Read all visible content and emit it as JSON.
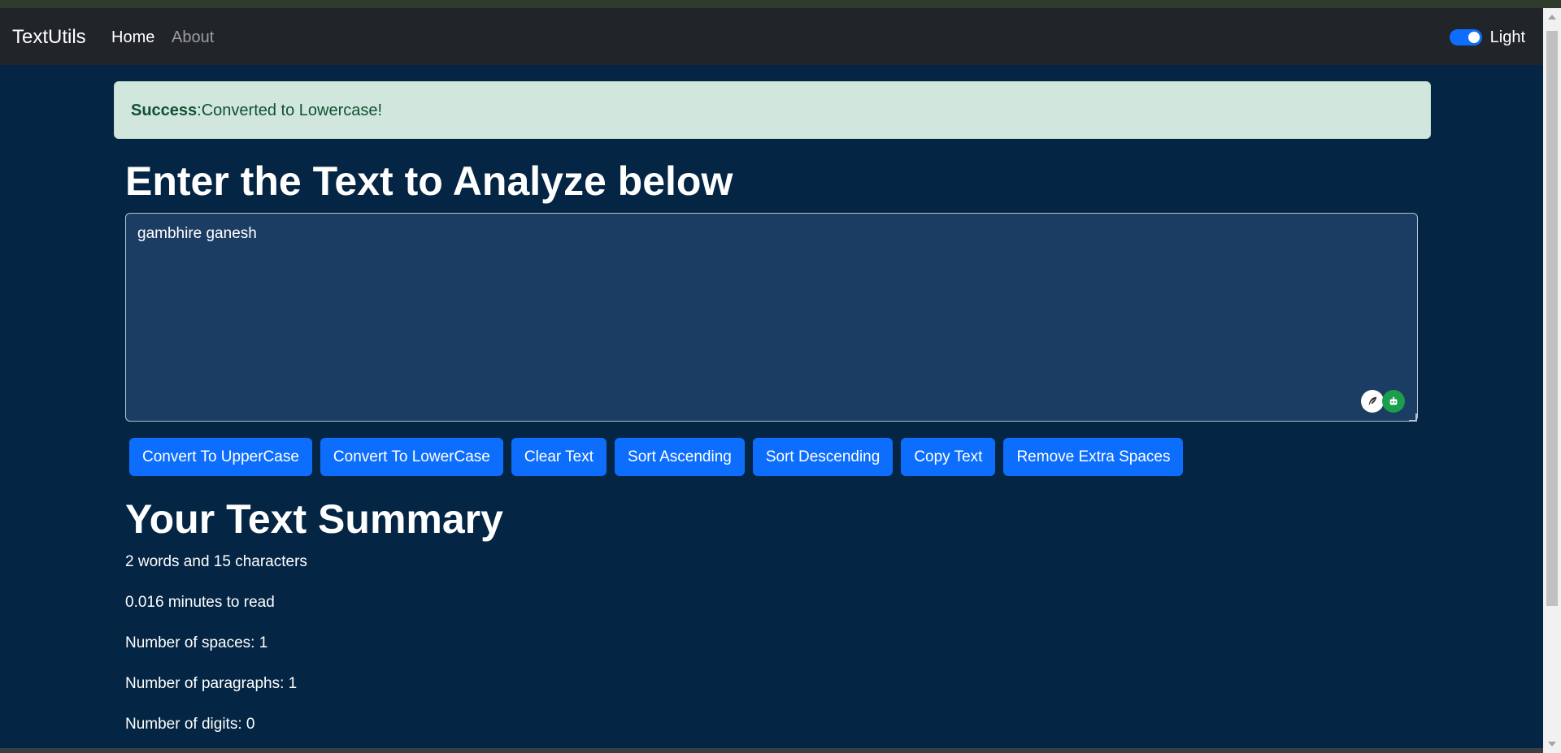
{
  "navbar": {
    "brand": "TextUtils",
    "links": [
      {
        "label": "Home"
      },
      {
        "label": "About"
      }
    ],
    "mode_toggle": {
      "label": "Light",
      "on": true
    }
  },
  "alert": {
    "type": "Success",
    "message": ":Converted to Lowercase!",
    "color": "#d1e7dd"
  },
  "form": {
    "heading": "Enter the Text to Analyze below",
    "textarea_value": "gambhire ganesh",
    "buttons": [
      {
        "label": "Convert To UpperCase"
      },
      {
        "label": "Convert To LowerCase"
      },
      {
        "label": "Clear Text"
      },
      {
        "label": "Sort Ascending"
      },
      {
        "label": "Sort Descending"
      },
      {
        "label": "Copy Text"
      },
      {
        "label": "Remove Extra Spaces"
      }
    ],
    "button_color": "#0d6efd"
  },
  "summary": {
    "heading": "Your Text Summary",
    "lines": [
      "2 words and 15 characters",
      "0.016 minutes to read",
      "Number of spaces: 1",
      "Number of paragraphs: 1",
      "Number of digits: 0"
    ]
  },
  "extension_icons": [
    "feather-icon",
    "robot-icon"
  ],
  "theme": {
    "background": "#042543",
    "navbar": "#212529"
  }
}
